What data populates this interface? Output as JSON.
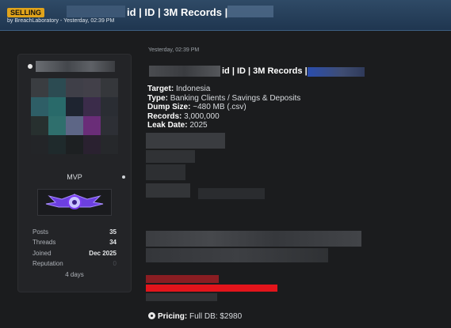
{
  "header": {
    "tag": "SELLING",
    "title": "id | ID | 3M Records |",
    "byline": "by BreachLaboratory - Yesterday, 02:39 PM"
  },
  "author": {
    "rank": "MVP",
    "stats": [
      {
        "label": "Posts",
        "value": "35"
      },
      {
        "label": "Threads",
        "value": "34"
      },
      {
        "label": "Joined",
        "value": "Dec 2025"
      },
      {
        "label": "Reputation",
        "value": "0"
      }
    ],
    "last_seen": "4 days"
  },
  "post": {
    "date": "Yesterday, 02:39 PM",
    "title": "id | ID | 3M Records |",
    "details": [
      {
        "label": "Target:",
        "value": "Indonesia"
      },
      {
        "label": "Type:",
        "value": "Banking Clients / Savings & Deposits"
      },
      {
        "label": "Dump Size:",
        "value": "~480 MB (.csv)"
      },
      {
        "label": "Records:",
        "value": "3,000,000"
      },
      {
        "label": "Leak Date:",
        "value": "2025"
      }
    ],
    "pricing_label": "Pricing:",
    "pricing_value": "Full DB: $2980"
  },
  "colors": {
    "header_bg": "#25405c",
    "tag_bg": "#e0a31b",
    "redacted_red": "#e3141b",
    "badge_purple": "#7a3df0"
  }
}
